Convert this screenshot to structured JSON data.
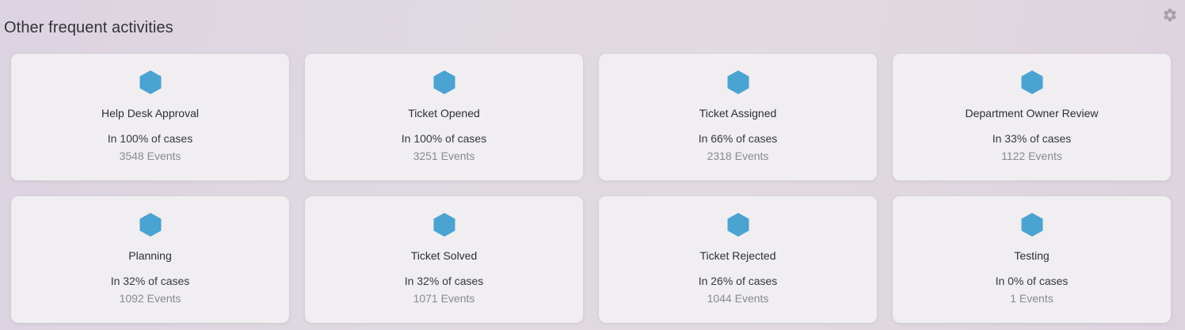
{
  "header": {
    "title": "Other frequent activities",
    "settings_icon": "gear-icon"
  },
  "colors": {
    "hexagon": "#4aa3d1",
    "card_bg": "#f0eef1",
    "gear": "#a5a2a7"
  },
  "activities": [
    {
      "name": "Help Desk Approval",
      "cases": "In 100% of cases",
      "events": "3548 Events"
    },
    {
      "name": "Ticket Opened",
      "cases": "In 100% of cases",
      "events": "3251 Events"
    },
    {
      "name": "Ticket Assigned",
      "cases": "In 66% of cases",
      "events": "2318 Events"
    },
    {
      "name": "Department Owner Review",
      "cases": "In 33% of cases",
      "events": "1122 Events"
    },
    {
      "name": "Planning",
      "cases": "In 32% of cases",
      "events": "1092 Events"
    },
    {
      "name": "Ticket Solved",
      "cases": "In 32% of cases",
      "events": "1071 Events"
    },
    {
      "name": "Ticket Rejected",
      "cases": "In 26% of cases",
      "events": "1044 Events"
    },
    {
      "name": "Testing",
      "cases": "In 0% of cases",
      "events": "1 Events"
    }
  ]
}
